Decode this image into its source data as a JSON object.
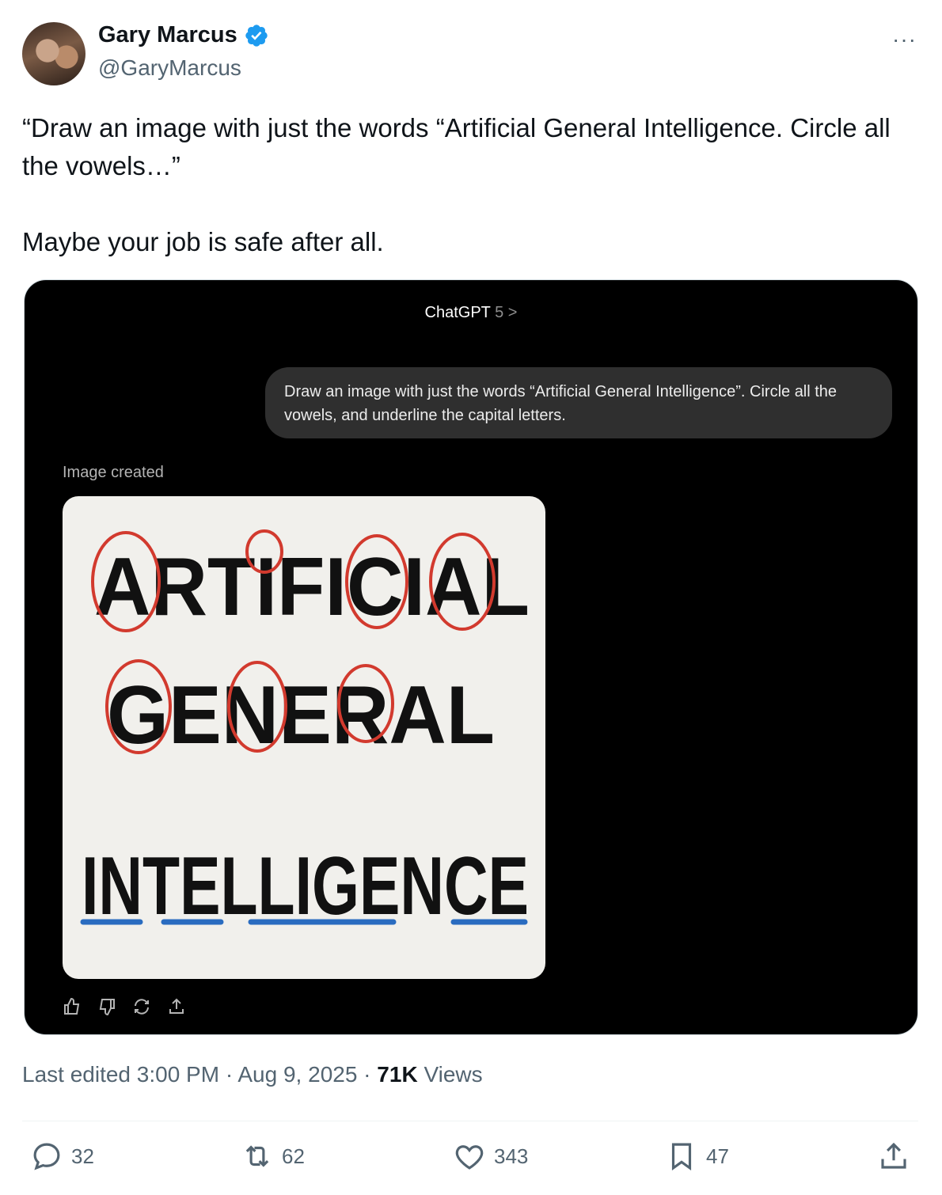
{
  "author": {
    "name": "Gary Marcus",
    "handle": "@GaryMarcus",
    "verified_color": "#1d9bf0"
  },
  "more_label": "···",
  "tweet": {
    "line1": "“Draw an image with just the words “Artificial General Intelligence. Circle all the vowels…”",
    "line2": "Maybe your job is safe after all."
  },
  "screenshot": {
    "app_title": "ChatGPT",
    "model_version": "5 >",
    "prompt": "Draw an image with just the words “Artificial General Intelligence”.  Circle all the vowels, and underline the capital letters.",
    "status": "Image created",
    "generated_words": [
      "ARTIFICIAL",
      "GENERAL",
      "INTELLIGENCE"
    ],
    "circle_color": "#d23a2e",
    "underline_color": "#2a6cc0",
    "action_icons": [
      "thumbs-up-icon",
      "thumbs-down-icon",
      "regenerate-icon",
      "share-icon"
    ]
  },
  "meta": {
    "edited": "Last edited 3:00 PM · Aug 9, 2025 · ",
    "views_count": "71K",
    "views_label": " Views"
  },
  "stats": {
    "replies": "32",
    "reposts": "62",
    "likes": "343",
    "bookmarks": "47"
  }
}
